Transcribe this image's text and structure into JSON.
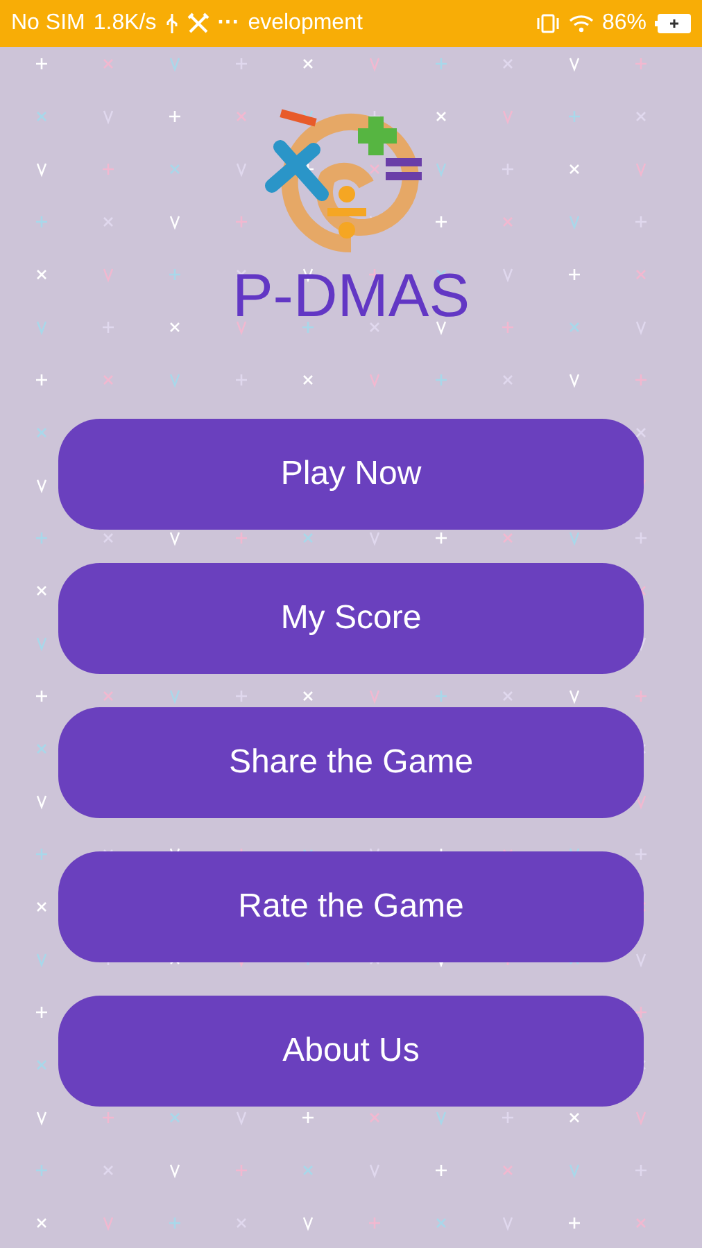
{
  "status_bar": {
    "carrier": "No SIM",
    "speed": "1.8K/s",
    "dots": "···",
    "ticker": "evelopment",
    "battery": "86%"
  },
  "app": {
    "title": "P-DMAS"
  },
  "menu": [
    {
      "label": "Play Now"
    },
    {
      "label": "My Score"
    },
    {
      "label": "Share the Game"
    },
    {
      "label": "Rate the Game"
    },
    {
      "label": "About Us"
    }
  ]
}
